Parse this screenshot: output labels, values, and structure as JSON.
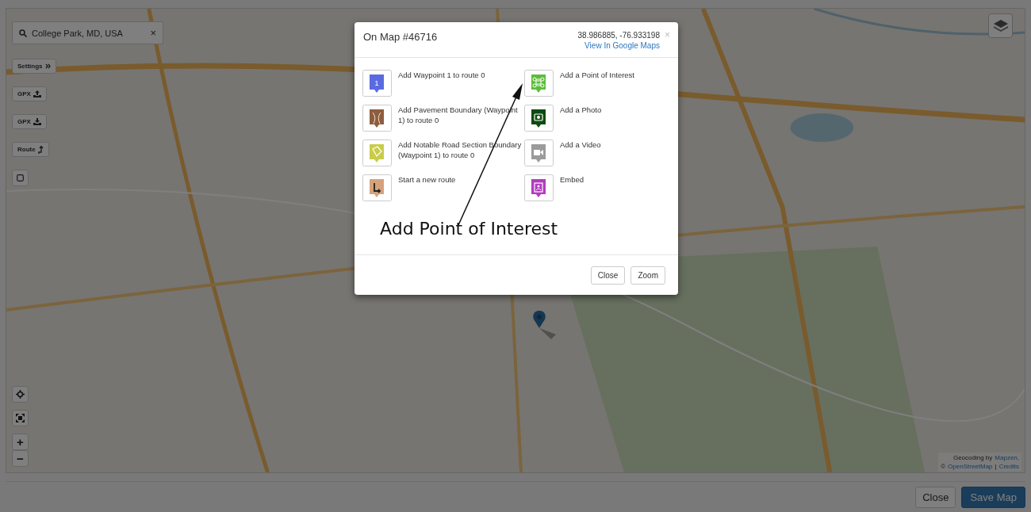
{
  "search": {
    "value": "College Park, MD, USA",
    "clear": "×"
  },
  "map_controls": [
    {
      "kind": "settings",
      "label": "Settings"
    },
    {
      "kind": "upload",
      "label": "GPX"
    },
    {
      "kind": "download",
      "label": "GPX"
    },
    {
      "kind": "route",
      "label": "Route"
    },
    {
      "kind": "square"
    }
  ],
  "zoom_controls": [
    {
      "kind": "locate"
    },
    {
      "kind": "fullscreen"
    },
    {
      "kind": "text",
      "label": "+"
    },
    {
      "kind": "text",
      "label": "−"
    }
  ],
  "attribution": {
    "line_1": {
      "text": "Geocoding by",
      "link": "Mapzen,"
    },
    "line_2": {
      "text": "©",
      "links": [
        "OpenStreetMap",
        "Credits"
      ],
      "separator": "|"
    }
  },
  "modal": {
    "title": "On Map #46716",
    "coordinates": "38.986885, -76.933198",
    "link": "View In Google Maps",
    "close": "×",
    "left_actions": [
      {
        "kind": "waypoint",
        "label": "Add Waypoint 1 to route 0",
        "badge": "1",
        "color": "#5a6be0"
      },
      {
        "kind": "pavement",
        "label": "Add Pavement Boundary (Waypoint 1) to route 0",
        "color": "#8e5d3d"
      },
      {
        "kind": "tag",
        "label": "Add Notable Road Section Boundary (Waypoint 1) to route 0",
        "color": "#c9cc48"
      },
      {
        "kind": "route",
        "label": "Start a new route",
        "color": "#d6a27a"
      }
    ],
    "right_actions": [
      {
        "kind": "poi",
        "label": "Add a Point of Interest",
        "color": "#5cbd3a"
      },
      {
        "label": "Add a Photo",
        "color": "#0d4b10"
      },
      {
        "kind": "video",
        "label": "Add a Video",
        "color": "#9b9b9b"
      },
      {
        "kind": "embed",
        "label": "Embed",
        "color": "#b23cbf"
      }
    ],
    "buttons": [
      "Close",
      "Zoom"
    ]
  },
  "annotation": "Add Point of Interest",
  "footer_buttons": [
    {
      "label": "Close",
      "kind": "default"
    },
    {
      "label": "Save Map",
      "kind": "primary"
    }
  ]
}
